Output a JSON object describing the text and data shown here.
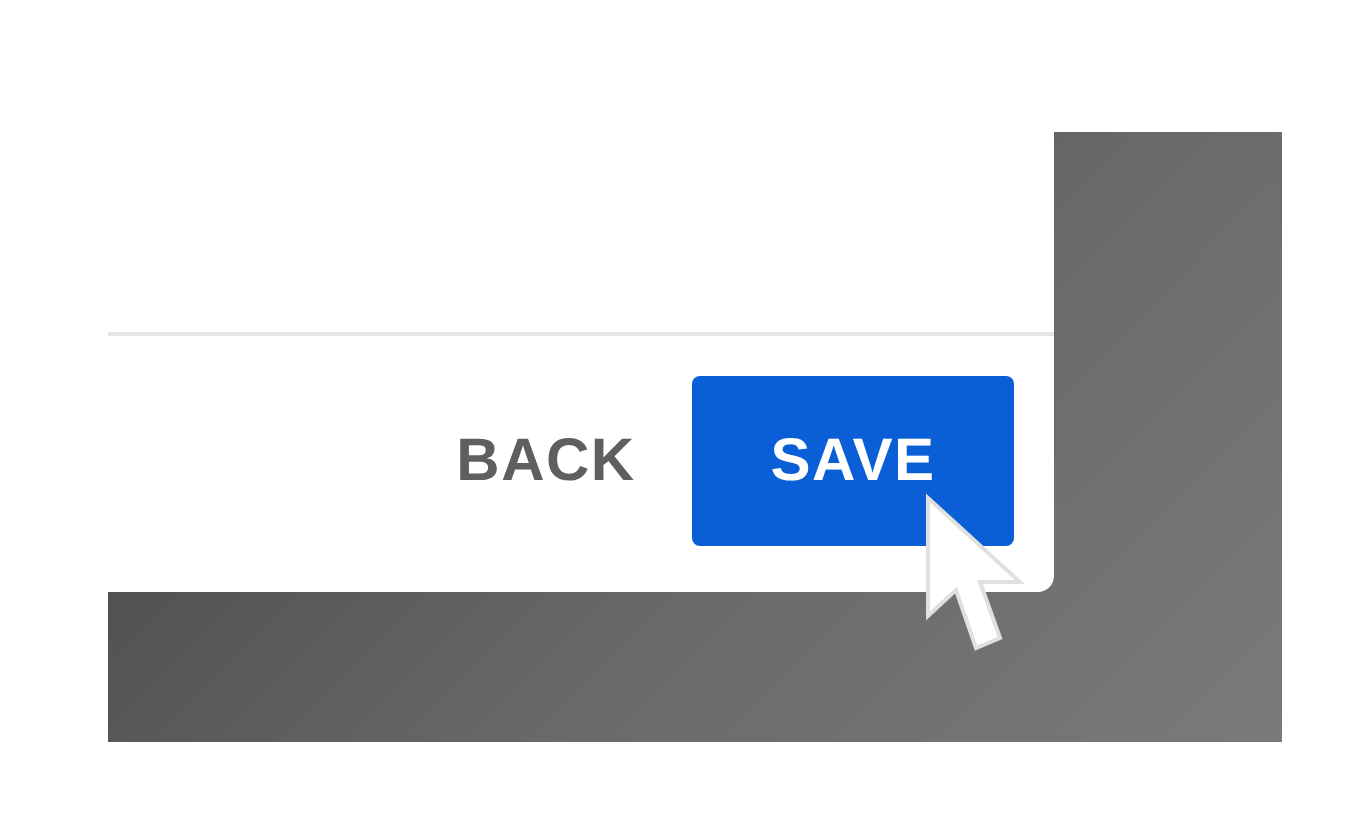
{
  "dialog": {
    "buttons": [
      {
        "label": "BACK",
        "kind": "text"
      },
      {
        "label": "SAVE",
        "kind": "primary"
      }
    ]
  }
}
